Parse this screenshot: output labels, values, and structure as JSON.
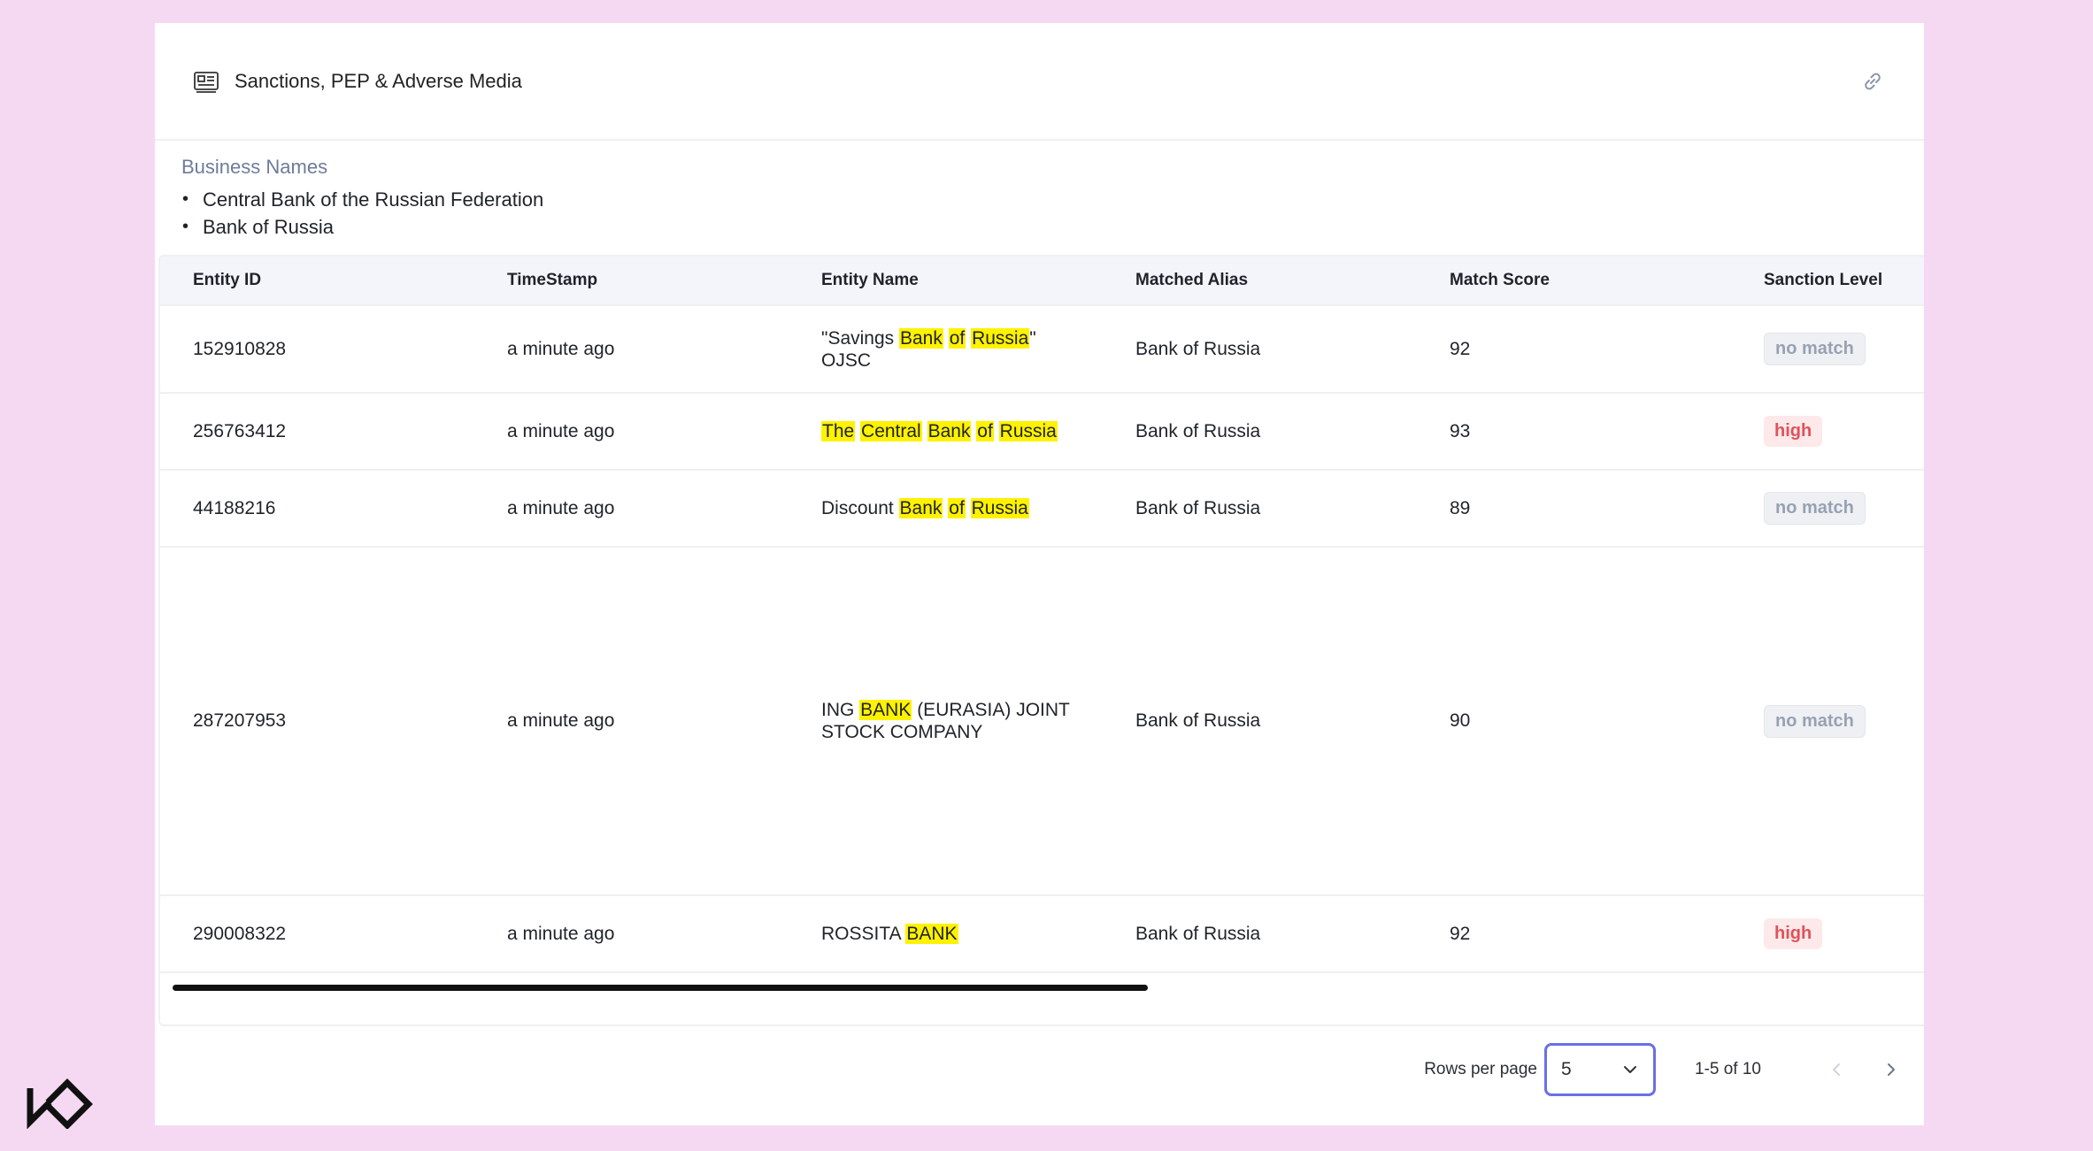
{
  "header": {
    "title": "Sanctions, PEP & Adverse Media",
    "icon": "id-card-icon",
    "action_icon": "link-icon"
  },
  "business": {
    "label": "Business Names",
    "items": [
      "Central Bank of the Russian Federation",
      "Bank of Russia"
    ]
  },
  "table": {
    "columns": [
      "Entity ID",
      "TimeStamp",
      "Entity Name",
      "Matched Alias",
      "Match Score",
      "Sanction Level"
    ],
    "rows": [
      {
        "id": "152910828",
        "timestamp": "a minute ago",
        "name": "\"Savings Bank of Russia\" OJSC",
        "alias": "Bank of Russia",
        "score": "92",
        "level": "no match"
      },
      {
        "id": "256763412",
        "timestamp": "a minute ago",
        "name": "The Central Bank of Russia",
        "alias": "Bank of Russia",
        "score": "93",
        "level": "high"
      },
      {
        "id": "44188216",
        "timestamp": "a minute ago",
        "name": "Discount Bank of Russia",
        "alias": "Bank of Russia",
        "score": "89",
        "level": "no match"
      },
      {
        "id": "287207953",
        "timestamp": "a minute ago",
        "name": "ING BANK (EURASIA) JOINT STOCK COMPANY",
        "alias": "Bank of Russia",
        "score": "90",
        "level": "no match"
      },
      {
        "id": "290008322",
        "timestamp": "a minute ago",
        "name": "ROSSITA BANK",
        "alias": "Bank of Russia",
        "score": "92",
        "level": "high"
      }
    ]
  },
  "pagination": {
    "rows_per_page_label": "Rows per page",
    "rows_per_page": "5",
    "range": "1-5 of 10"
  },
  "colors": {
    "background": "#f5d9f2",
    "highlight": "#fff200",
    "high": "#e0525a",
    "focus": "#6a6fe6"
  }
}
